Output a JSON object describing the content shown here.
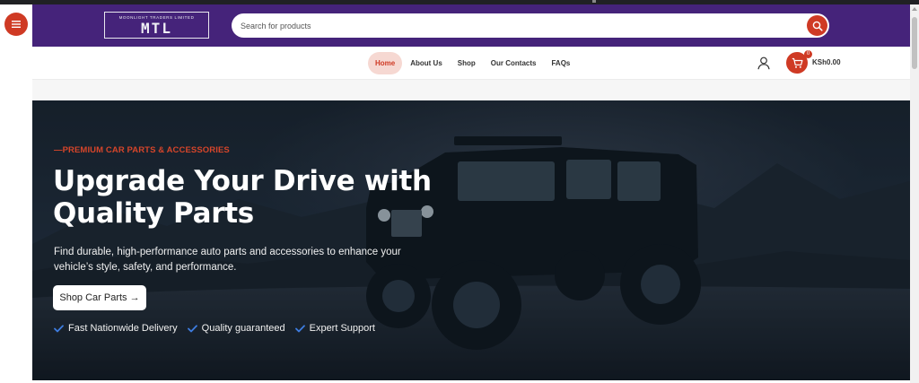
{
  "header": {
    "logo_top": "MOONLIGHT TRADERS LIMITED",
    "logo_main": "MTL",
    "search_placeholder": "Search for products"
  },
  "nav": {
    "items": [
      {
        "label": "Home",
        "active": true
      },
      {
        "label": "About Us"
      },
      {
        "label": "Shop"
      },
      {
        "label": "Our Contacts"
      },
      {
        "label": "FAQs"
      }
    ],
    "cart_count": "0",
    "cart_total": "KSh0.00"
  },
  "hero": {
    "eyebrow": "—PREMIUM CAR PARTS & ACCESSORIES",
    "title": "Upgrade Your Drive with Quality Parts",
    "description": "Find durable, high-performance auto parts and accessories to enhance your vehicle’s style, safety, and performance.",
    "cta_label": "Shop Car Parts →",
    "features": [
      "Fast Nationwide Delivery",
      "Quality guaranteed",
      "Expert Support"
    ]
  },
  "colors": {
    "header_bg": "#45237a",
    "accent": "#cf3a24",
    "hero_overlay": "#161d26"
  },
  "icons": [
    "hamburger-menu-icon",
    "search-icon",
    "user-icon",
    "cart-icon",
    "check-icon"
  ]
}
